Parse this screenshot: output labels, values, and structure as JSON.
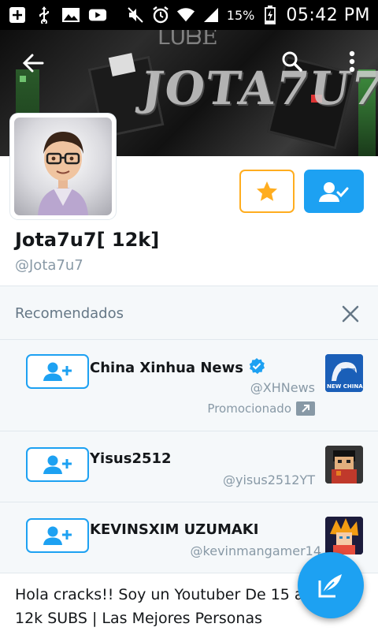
{
  "status_bar": {
    "battery_percent": "15%",
    "time": "05:42 PM",
    "icons": [
      "add-icon",
      "usb-icon",
      "image-icon",
      "youtube-icon",
      "mute-icon",
      "alarm-icon",
      "wifi-icon",
      "signal-icon",
      "battery-charging-icon"
    ]
  },
  "banner": {
    "top_text": "ᒪᑌᗷE",
    "logo_text": "JOTA7U7"
  },
  "profile": {
    "display_name": "Jota7u7[ 12k]",
    "handle": "@Jota7u7"
  },
  "recommendations": {
    "title": "Recomendados",
    "items": [
      {
        "name": "China Xinhua News",
        "verified": true,
        "handle": "@XHNews",
        "promoted": "Promocionado",
        "thumb_label": "NEW CHINA"
      },
      {
        "name": "Yisus2512",
        "verified": false,
        "handle": "@yisus2512YT"
      },
      {
        "name": "KEVINSXIM UZUMAKI",
        "verified": false,
        "handle": "@kevinmangamer14"
      }
    ]
  },
  "bio": {
    "text": "Hola cracks!! Soy un Youtuber De 15 años | 12k SUBS | Las Mejores Personas"
  },
  "colors": {
    "accent": "#1da1f2",
    "star": "#ffad1f",
    "muted": "#8899a6"
  }
}
